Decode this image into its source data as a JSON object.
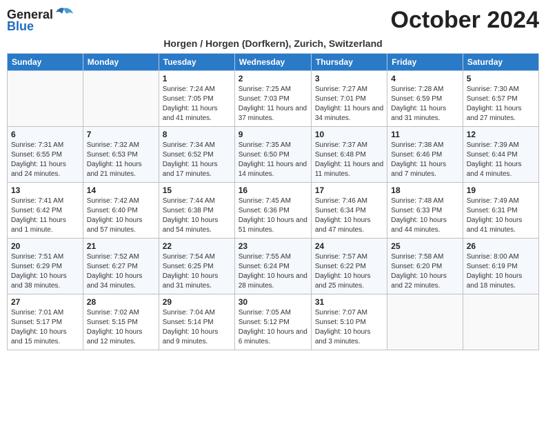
{
  "header": {
    "logo_general": "General",
    "logo_blue": "Blue",
    "month_year": "October 2024",
    "location": "Horgen / Horgen (Dorfkern), Zurich, Switzerland"
  },
  "weekdays": [
    "Sunday",
    "Monday",
    "Tuesday",
    "Wednesday",
    "Thursday",
    "Friday",
    "Saturday"
  ],
  "weeks": [
    [
      {
        "day": "",
        "info": ""
      },
      {
        "day": "",
        "info": ""
      },
      {
        "day": "1",
        "info": "Sunrise: 7:24 AM\nSunset: 7:05 PM\nDaylight: 11 hours and 41 minutes."
      },
      {
        "day": "2",
        "info": "Sunrise: 7:25 AM\nSunset: 7:03 PM\nDaylight: 11 hours and 37 minutes."
      },
      {
        "day": "3",
        "info": "Sunrise: 7:27 AM\nSunset: 7:01 PM\nDaylight: 11 hours and 34 minutes."
      },
      {
        "day": "4",
        "info": "Sunrise: 7:28 AM\nSunset: 6:59 PM\nDaylight: 11 hours and 31 minutes."
      },
      {
        "day": "5",
        "info": "Sunrise: 7:30 AM\nSunset: 6:57 PM\nDaylight: 11 hours and 27 minutes."
      }
    ],
    [
      {
        "day": "6",
        "info": "Sunrise: 7:31 AM\nSunset: 6:55 PM\nDaylight: 11 hours and 24 minutes."
      },
      {
        "day": "7",
        "info": "Sunrise: 7:32 AM\nSunset: 6:53 PM\nDaylight: 11 hours and 21 minutes."
      },
      {
        "day": "8",
        "info": "Sunrise: 7:34 AM\nSunset: 6:52 PM\nDaylight: 11 hours and 17 minutes."
      },
      {
        "day": "9",
        "info": "Sunrise: 7:35 AM\nSunset: 6:50 PM\nDaylight: 11 hours and 14 minutes."
      },
      {
        "day": "10",
        "info": "Sunrise: 7:37 AM\nSunset: 6:48 PM\nDaylight: 11 hours and 11 minutes."
      },
      {
        "day": "11",
        "info": "Sunrise: 7:38 AM\nSunset: 6:46 PM\nDaylight: 11 hours and 7 minutes."
      },
      {
        "day": "12",
        "info": "Sunrise: 7:39 AM\nSunset: 6:44 PM\nDaylight: 11 hours and 4 minutes."
      }
    ],
    [
      {
        "day": "13",
        "info": "Sunrise: 7:41 AM\nSunset: 6:42 PM\nDaylight: 11 hours and 1 minute."
      },
      {
        "day": "14",
        "info": "Sunrise: 7:42 AM\nSunset: 6:40 PM\nDaylight: 10 hours and 57 minutes."
      },
      {
        "day": "15",
        "info": "Sunrise: 7:44 AM\nSunset: 6:38 PM\nDaylight: 10 hours and 54 minutes."
      },
      {
        "day": "16",
        "info": "Sunrise: 7:45 AM\nSunset: 6:36 PM\nDaylight: 10 hours and 51 minutes."
      },
      {
        "day": "17",
        "info": "Sunrise: 7:46 AM\nSunset: 6:34 PM\nDaylight: 10 hours and 47 minutes."
      },
      {
        "day": "18",
        "info": "Sunrise: 7:48 AM\nSunset: 6:33 PM\nDaylight: 10 hours and 44 minutes."
      },
      {
        "day": "19",
        "info": "Sunrise: 7:49 AM\nSunset: 6:31 PM\nDaylight: 10 hours and 41 minutes."
      }
    ],
    [
      {
        "day": "20",
        "info": "Sunrise: 7:51 AM\nSunset: 6:29 PM\nDaylight: 10 hours and 38 minutes."
      },
      {
        "day": "21",
        "info": "Sunrise: 7:52 AM\nSunset: 6:27 PM\nDaylight: 10 hours and 34 minutes."
      },
      {
        "day": "22",
        "info": "Sunrise: 7:54 AM\nSunset: 6:25 PM\nDaylight: 10 hours and 31 minutes."
      },
      {
        "day": "23",
        "info": "Sunrise: 7:55 AM\nSunset: 6:24 PM\nDaylight: 10 hours and 28 minutes."
      },
      {
        "day": "24",
        "info": "Sunrise: 7:57 AM\nSunset: 6:22 PM\nDaylight: 10 hours and 25 minutes."
      },
      {
        "day": "25",
        "info": "Sunrise: 7:58 AM\nSunset: 6:20 PM\nDaylight: 10 hours and 22 minutes."
      },
      {
        "day": "26",
        "info": "Sunrise: 8:00 AM\nSunset: 6:19 PM\nDaylight: 10 hours and 18 minutes."
      }
    ],
    [
      {
        "day": "27",
        "info": "Sunrise: 7:01 AM\nSunset: 5:17 PM\nDaylight: 10 hours and 15 minutes."
      },
      {
        "day": "28",
        "info": "Sunrise: 7:02 AM\nSunset: 5:15 PM\nDaylight: 10 hours and 12 minutes."
      },
      {
        "day": "29",
        "info": "Sunrise: 7:04 AM\nSunset: 5:14 PM\nDaylight: 10 hours and 9 minutes."
      },
      {
        "day": "30",
        "info": "Sunrise: 7:05 AM\nSunset: 5:12 PM\nDaylight: 10 hours and 6 minutes."
      },
      {
        "day": "31",
        "info": "Sunrise: 7:07 AM\nSunset: 5:10 PM\nDaylight: 10 hours and 3 minutes."
      },
      {
        "day": "",
        "info": ""
      },
      {
        "day": "",
        "info": ""
      }
    ]
  ]
}
